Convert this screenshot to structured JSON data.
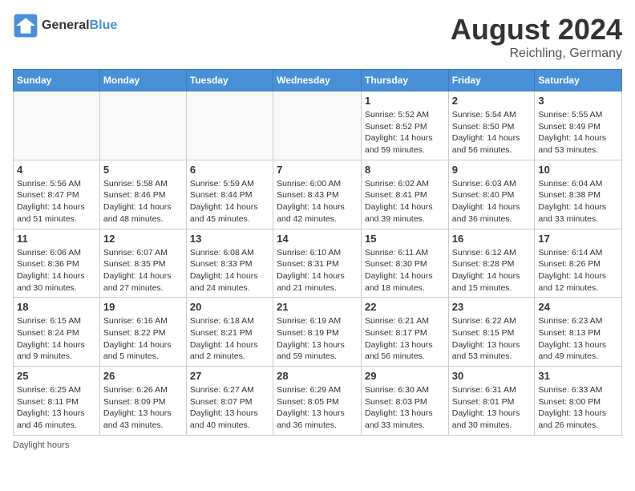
{
  "header": {
    "logo_general": "General",
    "logo_blue": "Blue",
    "month_year": "August 2024",
    "location": "Reichling, Germany"
  },
  "calendar": {
    "days_of_week": [
      "Sunday",
      "Monday",
      "Tuesday",
      "Wednesday",
      "Thursday",
      "Friday",
      "Saturday"
    ],
    "weeks": [
      [
        {
          "day": "",
          "info": ""
        },
        {
          "day": "",
          "info": ""
        },
        {
          "day": "",
          "info": ""
        },
        {
          "day": "",
          "info": ""
        },
        {
          "day": "1",
          "info": "Sunrise: 5:52 AM\nSunset: 8:52 PM\nDaylight: 14 hours and 59 minutes."
        },
        {
          "day": "2",
          "info": "Sunrise: 5:54 AM\nSunset: 8:50 PM\nDaylight: 14 hours and 56 minutes."
        },
        {
          "day": "3",
          "info": "Sunrise: 5:55 AM\nSunset: 8:49 PM\nDaylight: 14 hours and 53 minutes."
        }
      ],
      [
        {
          "day": "4",
          "info": "Sunrise: 5:56 AM\nSunset: 8:47 PM\nDaylight: 14 hours and 51 minutes."
        },
        {
          "day": "5",
          "info": "Sunrise: 5:58 AM\nSunset: 8:46 PM\nDaylight: 14 hours and 48 minutes."
        },
        {
          "day": "6",
          "info": "Sunrise: 5:59 AM\nSunset: 8:44 PM\nDaylight: 14 hours and 45 minutes."
        },
        {
          "day": "7",
          "info": "Sunrise: 6:00 AM\nSunset: 8:43 PM\nDaylight: 14 hours and 42 minutes."
        },
        {
          "day": "8",
          "info": "Sunrise: 6:02 AM\nSunset: 8:41 PM\nDaylight: 14 hours and 39 minutes."
        },
        {
          "day": "9",
          "info": "Sunrise: 6:03 AM\nSunset: 8:40 PM\nDaylight: 14 hours and 36 minutes."
        },
        {
          "day": "10",
          "info": "Sunrise: 6:04 AM\nSunset: 8:38 PM\nDaylight: 14 hours and 33 minutes."
        }
      ],
      [
        {
          "day": "11",
          "info": "Sunrise: 6:06 AM\nSunset: 8:36 PM\nDaylight: 14 hours and 30 minutes."
        },
        {
          "day": "12",
          "info": "Sunrise: 6:07 AM\nSunset: 8:35 PM\nDaylight: 14 hours and 27 minutes."
        },
        {
          "day": "13",
          "info": "Sunrise: 6:08 AM\nSunset: 8:33 PM\nDaylight: 14 hours and 24 minutes."
        },
        {
          "day": "14",
          "info": "Sunrise: 6:10 AM\nSunset: 8:31 PM\nDaylight: 14 hours and 21 minutes."
        },
        {
          "day": "15",
          "info": "Sunrise: 6:11 AM\nSunset: 8:30 PM\nDaylight: 14 hours and 18 minutes."
        },
        {
          "day": "16",
          "info": "Sunrise: 6:12 AM\nSunset: 8:28 PM\nDaylight: 14 hours and 15 minutes."
        },
        {
          "day": "17",
          "info": "Sunrise: 6:14 AM\nSunset: 8:26 PM\nDaylight: 14 hours and 12 minutes."
        }
      ],
      [
        {
          "day": "18",
          "info": "Sunrise: 6:15 AM\nSunset: 8:24 PM\nDaylight: 14 hours and 9 minutes."
        },
        {
          "day": "19",
          "info": "Sunrise: 6:16 AM\nSunset: 8:22 PM\nDaylight: 14 hours and 5 minutes."
        },
        {
          "day": "20",
          "info": "Sunrise: 6:18 AM\nSunset: 8:21 PM\nDaylight: 14 hours and 2 minutes."
        },
        {
          "day": "21",
          "info": "Sunrise: 6:19 AM\nSunset: 8:19 PM\nDaylight: 13 hours and 59 minutes."
        },
        {
          "day": "22",
          "info": "Sunrise: 6:21 AM\nSunset: 8:17 PM\nDaylight: 13 hours and 56 minutes."
        },
        {
          "day": "23",
          "info": "Sunrise: 6:22 AM\nSunset: 8:15 PM\nDaylight: 13 hours and 53 minutes."
        },
        {
          "day": "24",
          "info": "Sunrise: 6:23 AM\nSunset: 8:13 PM\nDaylight: 13 hours and 49 minutes."
        }
      ],
      [
        {
          "day": "25",
          "info": "Sunrise: 6:25 AM\nSunset: 8:11 PM\nDaylight: 13 hours and 46 minutes."
        },
        {
          "day": "26",
          "info": "Sunrise: 6:26 AM\nSunset: 8:09 PM\nDaylight: 13 hours and 43 minutes."
        },
        {
          "day": "27",
          "info": "Sunrise: 6:27 AM\nSunset: 8:07 PM\nDaylight: 13 hours and 40 minutes."
        },
        {
          "day": "28",
          "info": "Sunrise: 6:29 AM\nSunset: 8:05 PM\nDaylight: 13 hours and 36 minutes."
        },
        {
          "day": "29",
          "info": "Sunrise: 6:30 AM\nSunset: 8:03 PM\nDaylight: 13 hours and 33 minutes."
        },
        {
          "day": "30",
          "info": "Sunrise: 6:31 AM\nSunset: 8:01 PM\nDaylight: 13 hours and 30 minutes."
        },
        {
          "day": "31",
          "info": "Sunrise: 6:33 AM\nSunset: 8:00 PM\nDaylight: 13 hours and 26 minutes."
        }
      ]
    ],
    "footer_note": "Daylight hours"
  }
}
